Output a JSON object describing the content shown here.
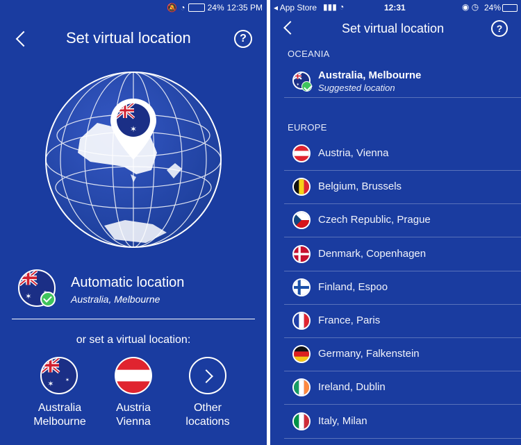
{
  "left_screen": {
    "status_bar": {
      "battery": "24%",
      "time": "12:35 PM"
    },
    "header": {
      "title": "Set virtual location",
      "help": "?"
    },
    "automatic": {
      "title": "Automatic location",
      "subtitle": "Australia, Melbourne"
    },
    "prompt": "or set a virtual location:",
    "options": [
      {
        "line1": "Australia",
        "line2": "Melbourne",
        "flag": "australia-flag"
      },
      {
        "line1": "Austria",
        "line2": "Vienna",
        "flag": "austria-flag"
      },
      {
        "line1": "Other",
        "line2": "locations",
        "icon": "chevron-right-icon"
      }
    ]
  },
  "right_screen": {
    "status_bar": {
      "carrier": "◂ App Store",
      "time": "12:31",
      "battery": "24%"
    },
    "header": {
      "title": "Set virtual location",
      "help": "?"
    },
    "oceania": {
      "section": "OCEANIA",
      "item": {
        "label": "Australia, Melbourne",
        "sublabel": "Suggested location"
      }
    },
    "europe": {
      "section": "EUROPE",
      "items": [
        {
          "label": "Austria, Vienna",
          "flag": "austria-flag"
        },
        {
          "label": "Belgium, Brussels",
          "flag": "belgium-flag"
        },
        {
          "label": "Czech Republic, Prague",
          "flag": "czech-flag"
        },
        {
          "label": "Denmark, Copenhagen",
          "flag": "denmark-flag"
        },
        {
          "label": "Finland, Espoo",
          "flag": "finland-flag"
        },
        {
          "label": "France, Paris",
          "flag": "france-flag"
        },
        {
          "label": "Germany, Falkenstein",
          "flag": "germany-flag"
        },
        {
          "label": "Ireland, Dublin",
          "flag": "ireland-flag"
        },
        {
          "label": "Italy, Milan",
          "flag": "italy-flag"
        }
      ]
    }
  },
  "colors": {
    "background": "#1a3ca0",
    "check": "#3fc45c",
    "divider": "#ffffff"
  }
}
